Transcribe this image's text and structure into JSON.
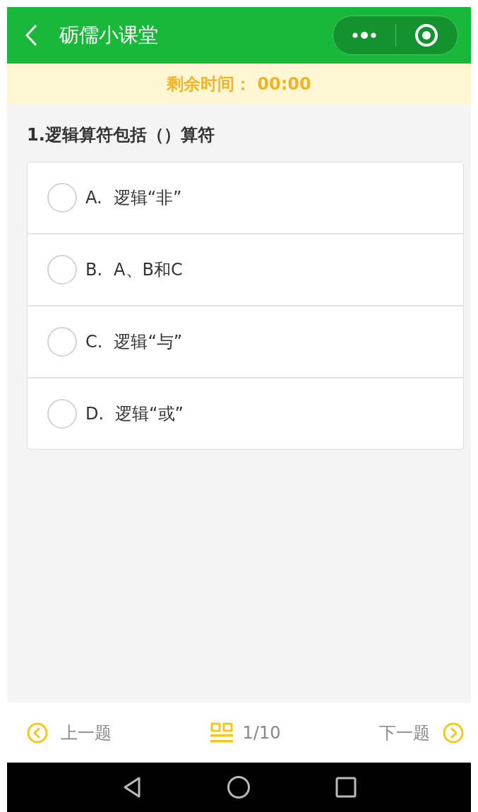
{
  "header": {
    "title": "砺儒小课堂"
  },
  "timer": {
    "label": "剩余时间：",
    "value": "00:00"
  },
  "question": {
    "title": "1.逻辑算符包括（）算符",
    "options": [
      {
        "letter": "A.",
        "text": "逻辑“非”",
        "selected": false
      },
      {
        "letter": "B.",
        "text": "A、B和C",
        "selected": false
      },
      {
        "letter": "C.",
        "text": "逻辑“与”",
        "selected": false
      },
      {
        "letter": "D.",
        "text": "逻辑“或”",
        "selected": false
      }
    ]
  },
  "footer": {
    "prev": "上一题",
    "progress": "1/10",
    "next": "下一题"
  }
}
